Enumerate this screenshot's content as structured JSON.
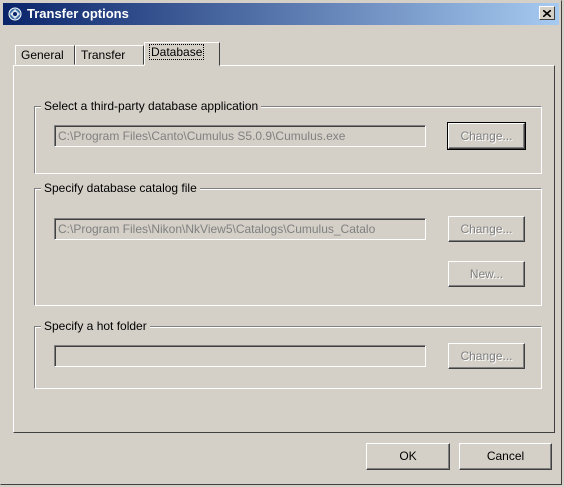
{
  "window": {
    "title": "Transfer options"
  },
  "tabs": [
    {
      "label": "General"
    },
    {
      "label": "Transfer"
    },
    {
      "label": "Database"
    }
  ],
  "groups": {
    "db_app": {
      "legend": "Select a third-party database application",
      "path_value": "C:\\Program Files\\Canto\\Cumulus S5.0.9\\Cumulus.exe",
      "change_label": "Change..."
    },
    "catalog": {
      "legend": "Specify database catalog file",
      "path_value": "C:\\Program Files\\Nikon\\NkView5\\Catalogs\\Cumulus_Catalo",
      "change_label": "Change...",
      "new_label": "New..."
    },
    "hot_folder": {
      "legend": "Specify a hot folder",
      "path_value": "",
      "change_label": "Change..."
    }
  },
  "footer": {
    "ok_label": "OK",
    "cancel_label": "Cancel"
  },
  "colors": {
    "face": "#d4d0c8",
    "titlebar_start": "#0a246a",
    "titlebar_end": "#a6caf0",
    "disabled_text": "#808080"
  },
  "icons": {
    "title": "transfer-app-icon",
    "close": "close-icon"
  }
}
